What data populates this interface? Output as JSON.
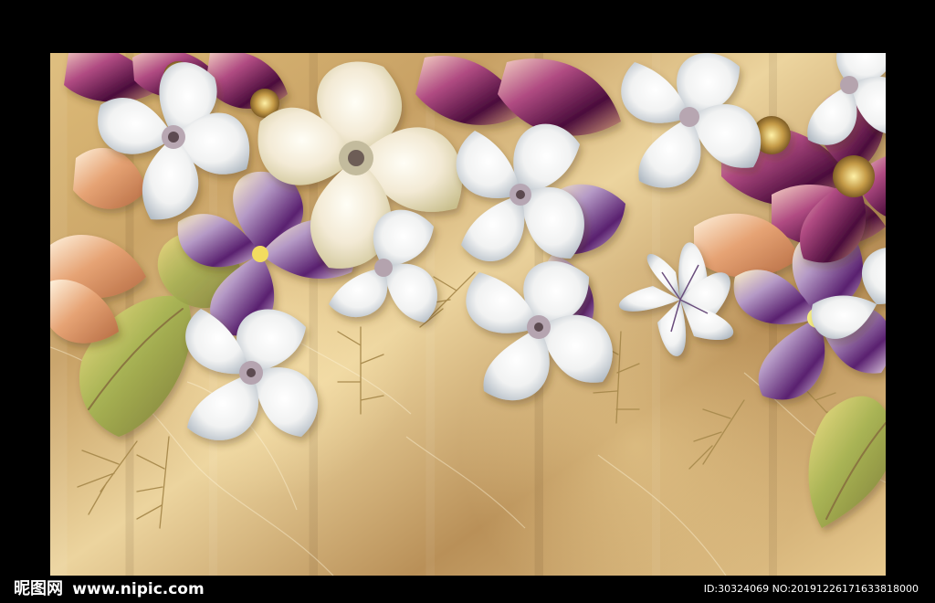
{
  "watermark": {
    "brand": "昵图网",
    "site": "www.nipic.com",
    "id_text": "ID:30324069 NO:20191226171633818000"
  },
  "colors": {
    "background": "#000000",
    "marble": "#d8b675",
    "white_petal": "#f4f3f2",
    "purple_petal": "#7a2c7a",
    "green_leaf": "#b8bd61",
    "gold_center": "#c9a04f"
  }
}
